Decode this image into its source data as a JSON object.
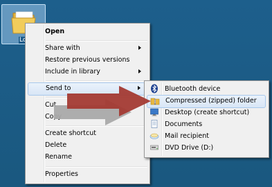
{
  "desktop_icon": {
    "label": "Lo"
  },
  "context_menu": {
    "items": [
      {
        "label": "Open"
      },
      {
        "label": "Share with"
      },
      {
        "label": "Restore previous versions"
      },
      {
        "label": "Include in library"
      },
      {
        "label": "Send to"
      },
      {
        "label": "Cut"
      },
      {
        "label": "Copy"
      },
      {
        "label": "Create shortcut"
      },
      {
        "label": "Delete"
      },
      {
        "label": "Rename"
      },
      {
        "label": "Properties"
      }
    ]
  },
  "send_to_menu": {
    "items": [
      {
        "label": "Bluetooth device",
        "icon": "bluetooth-icon"
      },
      {
        "label": "Compressed (zipped) folder",
        "icon": "zip-folder-icon"
      },
      {
        "label": "Desktop (create shortcut)",
        "icon": "desktop-icon"
      },
      {
        "label": "Documents",
        "icon": "documents-icon"
      },
      {
        "label": "Mail recipient",
        "icon": "mail-icon"
      },
      {
        "label": "DVD Drive (D:)",
        "icon": "dvd-drive-icon"
      }
    ]
  },
  "colors": {
    "desktop": "#1d5f8c",
    "highlight": "#d8e6f6",
    "arrow_red": "#a33a33",
    "arrow_gray": "#a9a9a9"
  }
}
